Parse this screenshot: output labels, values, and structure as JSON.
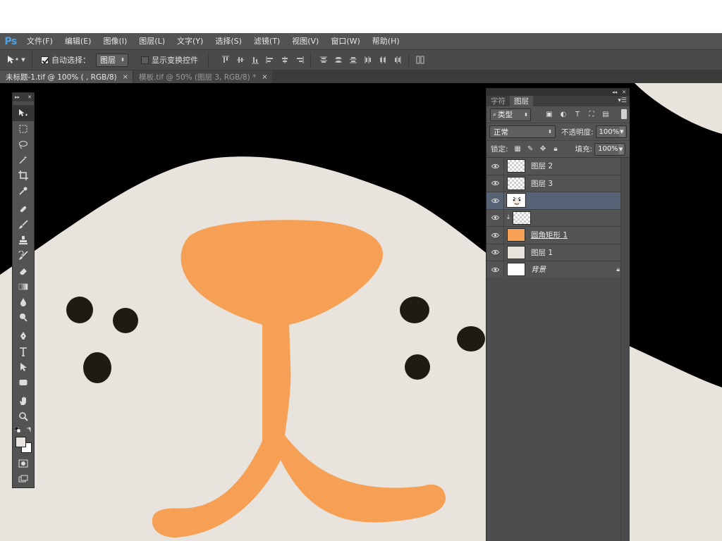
{
  "app": {
    "logo": "Ps",
    "menu": [
      "文件(F)",
      "编辑(E)",
      "图像(I)",
      "图层(L)",
      "文字(Y)",
      "选择(S)",
      "滤镜(T)",
      "视图(V)",
      "窗口(W)",
      "帮助(H)"
    ]
  },
  "options": {
    "auto_select_label": "自动选择：",
    "auto_select_target": "图层",
    "show_transform_label": "显示变换控件"
  },
  "tabs": [
    {
      "label": "未标题-1.tif @ 100% ( , RGB/8)",
      "close": "×"
    },
    {
      "label": "模板.tif @ 50% (图层 3, RGB/8) *",
      "close": "×"
    }
  ],
  "tools": [
    "move-tool",
    "marquee-tool",
    "lasso-tool",
    "magic-wand-tool",
    "crop-tool",
    "eyedropper-tool",
    "healing-brush-tool",
    "brush-tool",
    "clone-stamp-tool",
    "history-brush-tool",
    "eraser-tool",
    "gradient-tool",
    "blur-tool",
    "dodge-tool",
    "pen-tool",
    "type-tool",
    "path-selection-tool",
    "rectangle-tool",
    "hand-tool",
    "zoom-tool"
  ],
  "colors": {
    "foreground": "#e8e4df",
    "background": "#ffffff",
    "canvas_face": "#e9e3dd",
    "nose": "#f5a055",
    "dots": "#1f1a12"
  },
  "layers_panel": {
    "tab_character": "字符",
    "tab_layers": "图层",
    "filter_kind": "类型",
    "blend_mode": "正常",
    "opacity_label": "不透明度:",
    "opacity_value": "100%",
    "lock_label": "锁定:",
    "fill_label": "填充:",
    "fill_value": "100%",
    "layers": [
      {
        "name": "图层 2",
        "thumb": "checker",
        "selected": false,
        "clipped": false
      },
      {
        "name": "图层 3",
        "thumb": "checker",
        "selected": false,
        "clipped": false
      },
      {
        "name": "",
        "thumb": "face",
        "selected": true,
        "clipped": false
      },
      {
        "name": "",
        "thumb": "checker",
        "selected": false,
        "clipped": true
      },
      {
        "name": "圆角矩形 1",
        "thumb": "orange",
        "selected": false,
        "clipped": false
      },
      {
        "name": "图层 1",
        "thumb": "cream",
        "selected": false,
        "clipped": false
      },
      {
        "name": "背景",
        "thumb": "white",
        "selected": false,
        "clipped": false,
        "locked": true
      }
    ]
  }
}
